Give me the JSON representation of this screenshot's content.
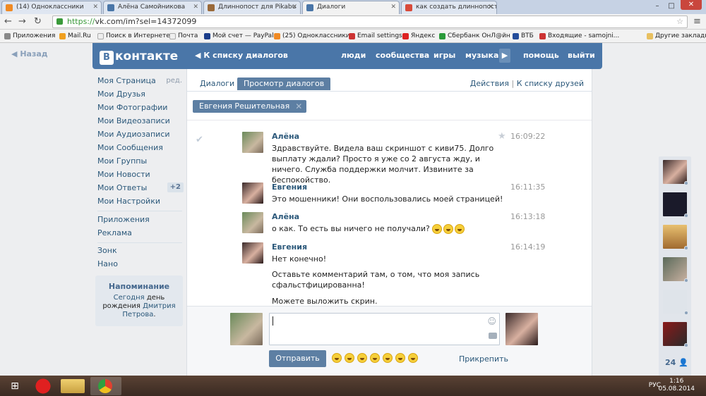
{
  "browser": {
    "tabs": [
      {
        "title": "(14) Одноклассники",
        "fav": "#f08a24"
      },
      {
        "title": "Алёна Самойникова",
        "fav": "#4a76a8"
      },
      {
        "title": "Длиннопост для Pikabu",
        "fav": "#9a6a3a"
      },
      {
        "title": "Диалоги",
        "fav": "#4a76a8"
      },
      {
        "title": "как создать длиннопост",
        "fav": "#d84a3a"
      }
    ],
    "url_scheme": "https://",
    "url_rest": "vk.com/im?sel=14372099",
    "bookmarks": [
      "Приложения",
      "Mail.Ru",
      "Поиск в Интернете",
      "Почта",
      "Мой счет — PayPal",
      "(25) Одноклассники",
      "Email settings",
      "Яндекс",
      "Сбербанк ОнЛ@йн",
      "ВТБ",
      "Входящие - samojni...",
      "Другие закладки"
    ]
  },
  "vk": {
    "back": "Назад",
    "logo": "контакте",
    "logo_b": "В",
    "to_dialogs": "К списку диалогов",
    "nav": [
      "люди",
      "сообщества",
      "игры",
      "музыка",
      "помощь",
      "выйти"
    ],
    "sidebar": [
      {
        "label": "Моя Страница",
        "aux": "ред."
      },
      {
        "label": "Мои Друзья"
      },
      {
        "label": "Мои Фотографии"
      },
      {
        "label": "Мои Видеозаписи"
      },
      {
        "label": "Мои Аудиозаписи"
      },
      {
        "label": "Мои Сообщения"
      },
      {
        "label": "Мои Группы"
      },
      {
        "label": "Мои Новости"
      },
      {
        "label": "Мои Ответы",
        "badge": "+2"
      },
      {
        "label": "Мои Настройки"
      }
    ],
    "sidebar2": [
      "Приложения",
      "Реклама"
    ],
    "sidebar3": [
      "Зонк",
      "Нано"
    ],
    "reminder": {
      "title": "Напоминание",
      "pre": "Сегодня",
      "day": "день",
      "mid": "рождения",
      "name": "Дмитрия Петрова",
      "end": "."
    },
    "tabs": [
      "Диалоги",
      "Просмотр диалогов"
    ],
    "actions": "Действия",
    "actions_sep": "|",
    "to_friends": "К списку друзей",
    "filter_chip": "Евгения Решительная",
    "messages": [
      {
        "name": "Алёна",
        "time": "16:09:22",
        "text": "Здравствуйте. Видела ваш скриншот с киви75. Долго выплату ждали? Просто я уже со 2 августа жду, и ничего. Служба поддержки молчит. Извините за беспокойство."
      },
      {
        "name": "Евгения",
        "time": "16:11:35",
        "text": "Это мошенники! Они воспользовались моей страницей!"
      },
      {
        "name": "Алёна",
        "time": "16:13:18",
        "text": "о как. То есть вы ничего не получали?"
      },
      {
        "name": "Евгения",
        "time": "16:14:19",
        "text": "Нет конечно!",
        "text2": "Оставьте комментарий там, о том, что моя запись сфальстфицированна!",
        "text3": "Можете выложить скрин."
      }
    ],
    "send": "Отправить",
    "attach": "Прикрепить",
    "friends_count": "24"
  },
  "taskbar": {
    "lang": "РУС",
    "time": "1:16",
    "date": "05.08.2014"
  },
  "colors": {
    "vk_blue": "#4a76a8",
    "link": "#2b587a"
  }
}
